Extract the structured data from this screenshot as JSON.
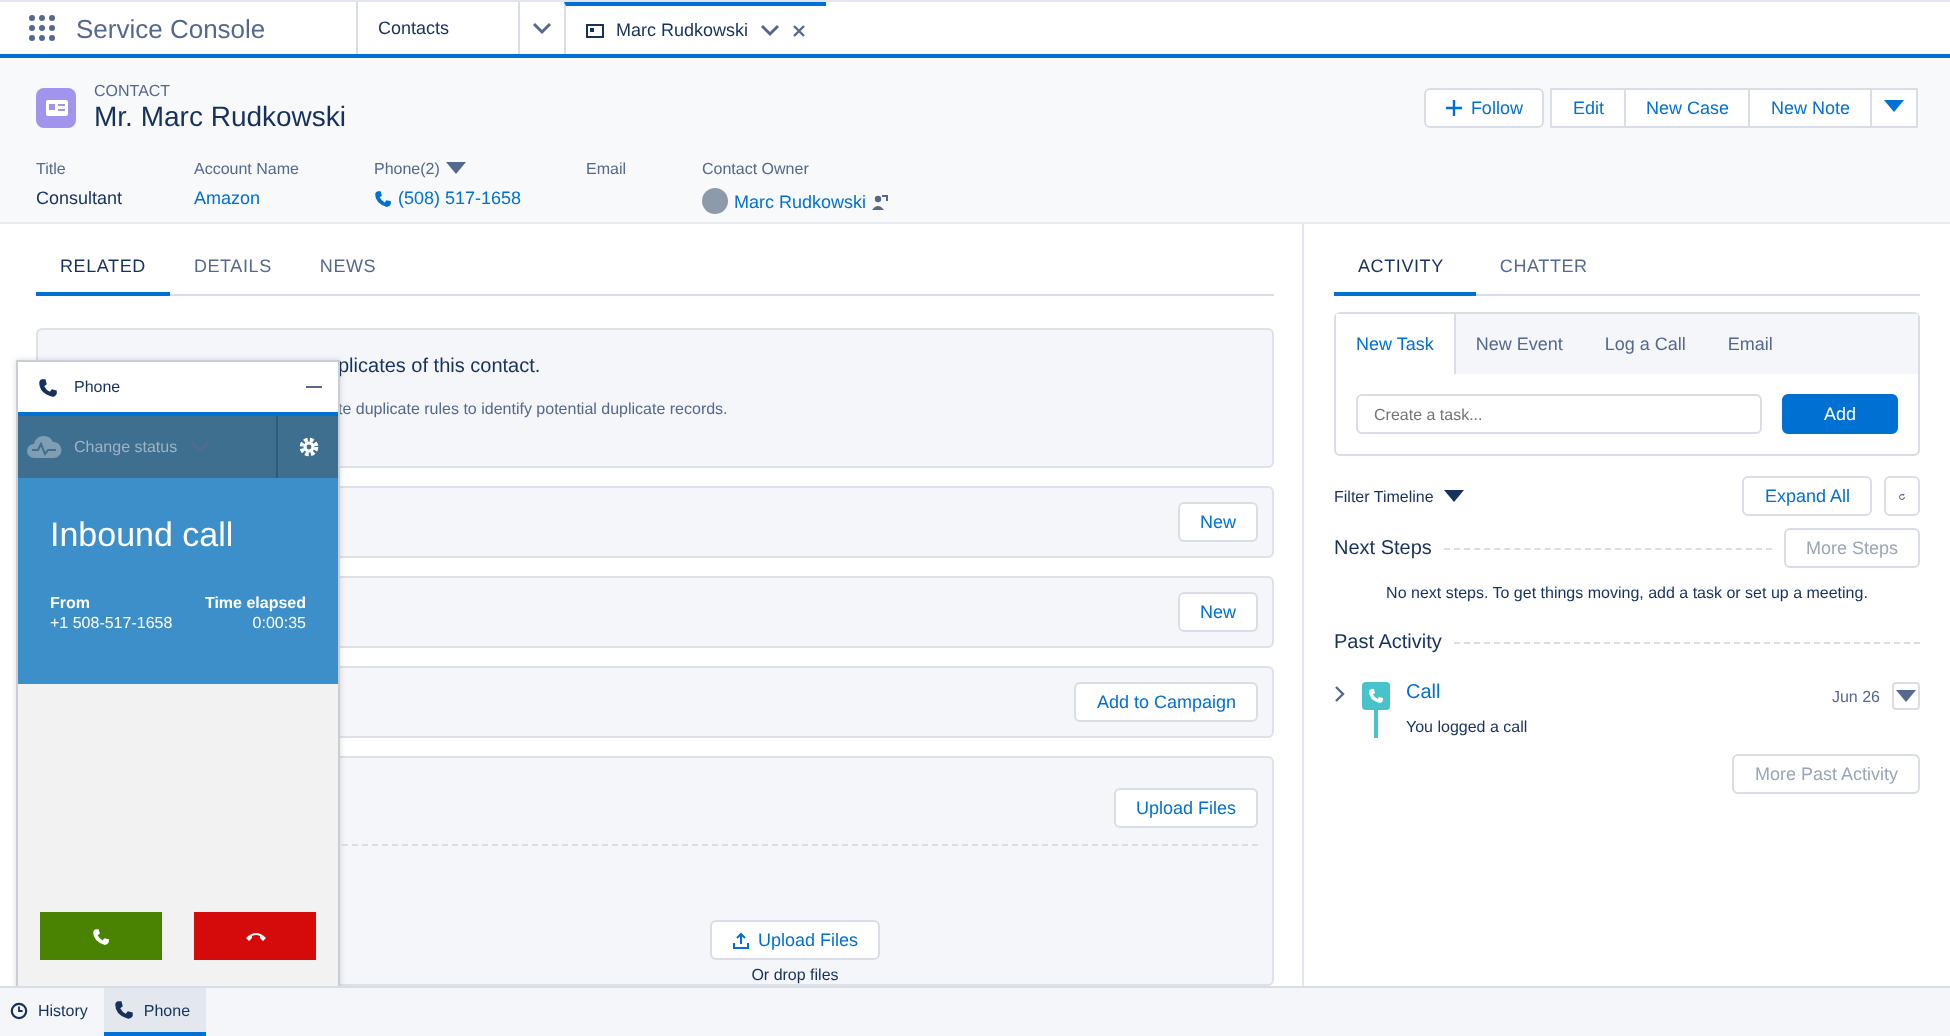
{
  "app": {
    "name": "Service Console"
  },
  "nav_tabs": [
    {
      "label": "Contacts",
      "kind": "object",
      "selected": false
    },
    {
      "label": "Marc Rudkowski",
      "kind": "record",
      "selected": true
    }
  ],
  "record": {
    "type_label": "CONTACT",
    "name": "Mr. Marc Rudkowski",
    "actions": [
      {
        "label": "Follow",
        "kind": "follow"
      },
      {
        "label": "Edit",
        "kind": "group"
      },
      {
        "label": "New Case",
        "kind": "group"
      },
      {
        "label": "New Note",
        "kind": "group"
      }
    ],
    "fields": [
      {
        "label": "Title",
        "value": "Consultant",
        "kind": "text"
      },
      {
        "label": "Account Name",
        "value": "Amazon",
        "kind": "link"
      },
      {
        "label": "Phone(2)",
        "value": "(508) 517-1658",
        "kind": "phone"
      },
      {
        "label": "Email",
        "kind": "empty"
      },
      {
        "label": "Contact Owner",
        "value": "Marc Rudkowski",
        "kind": "owner"
      }
    ]
  },
  "detail_tabs": [
    {
      "label": "RELATED",
      "selected": true
    },
    {
      "label": "DETAILS",
      "selected": false
    },
    {
      "label": "NEWS",
      "selected": false
    }
  ],
  "duplicates": {
    "title": "plicates of this contact.",
    "text": "te duplicate rules to identify potential duplicate records."
  },
  "related_cards": [
    {
      "button": "New",
      "kind": "plain"
    },
    {
      "button": "New",
      "kind": "plain"
    },
    {
      "button": "Add to Campaign",
      "kind": "plain"
    },
    {
      "button": "Upload Files",
      "kind": "files",
      "drop_button": "Upload Files",
      "drop_text": "Or drop files"
    }
  ],
  "activity_tabs": [
    {
      "label": "ACTIVITY",
      "selected": true
    },
    {
      "label": "CHATTER",
      "selected": false
    }
  ],
  "composer": {
    "tabs": [
      {
        "label": "New Task",
        "selected": true
      },
      {
        "label": "New Event",
        "selected": false
      },
      {
        "label": "Log a Call",
        "selected": false
      },
      {
        "label": "Email",
        "selected": false
      }
    ],
    "placeholder": "Create a task...",
    "button": "Add"
  },
  "timeline": {
    "filter": "Filter Timeline",
    "expand": "Expand All",
    "next_steps": {
      "title": "Next Steps",
      "button": "More Steps",
      "disabled": true,
      "empty": "No next steps. To get things moving, add a task or set up a meeting."
    },
    "past": {
      "title": "Past Activity",
      "button": "More Past Activity",
      "disabled": true,
      "items": [
        {
          "title": "Call",
          "subtitle": "You logged a call",
          "date": "Jun 26",
          "expanded": false
        }
      ]
    }
  },
  "phone_panel": {
    "title": "Phone",
    "status": "Change status",
    "call_title": "Inbound call",
    "from_label": "From",
    "from": "+1 508-517-1658",
    "elapsed_label": "Time elapsed",
    "elapsed": "0:00:35"
  },
  "utility_bar": [
    {
      "label": "History",
      "kind": "history",
      "selected": false
    },
    {
      "label": "Phone",
      "kind": "phone",
      "selected": true
    }
  ]
}
